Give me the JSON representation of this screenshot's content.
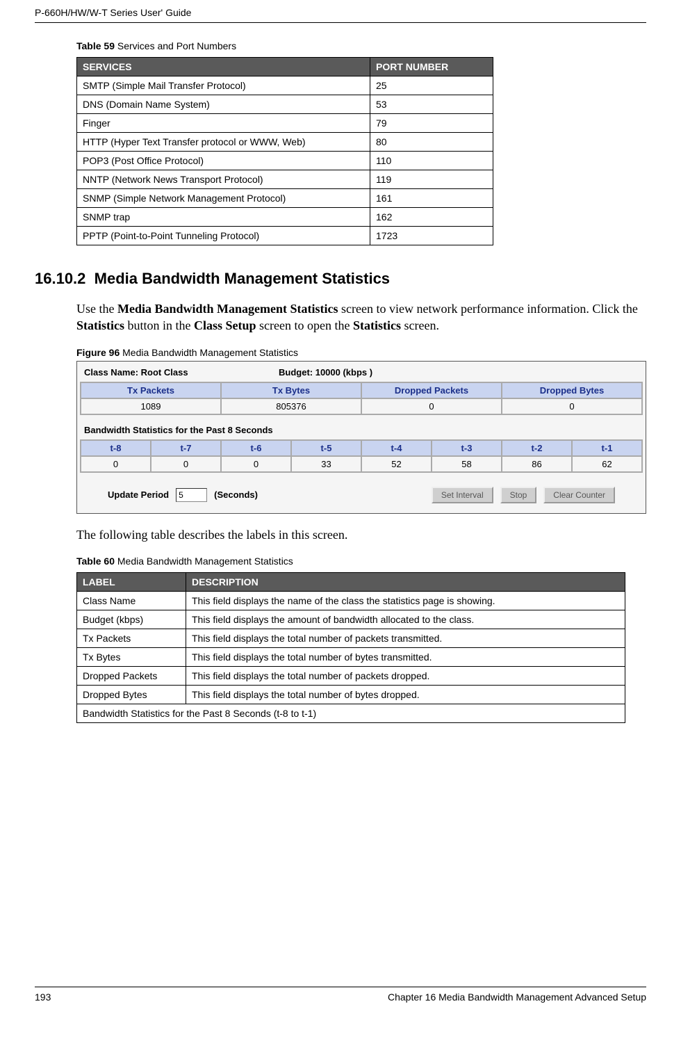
{
  "header": {
    "title": "P-660H/HW/W-T Series User' Guide"
  },
  "table59": {
    "caption_bold": "Table 59",
    "caption_rest": "   Services and Port Numbers",
    "headers": [
      "SERVICES",
      "PORT NUMBER"
    ],
    "rows": [
      [
        "SMTP (Simple Mail Transfer Protocol)",
        "25"
      ],
      [
        "DNS (Domain Name System)",
        "53"
      ],
      [
        "Finger",
        "79"
      ],
      [
        "HTTP (Hyper Text Transfer protocol or WWW, Web)",
        "80"
      ],
      [
        "POP3 (Post Office Protocol)",
        "110"
      ],
      [
        "NNTP (Network News Transport Protocol)",
        "119"
      ],
      [
        "SNMP (Simple Network Management Protocol)",
        "161"
      ],
      [
        "SNMP trap",
        "162"
      ],
      [
        "PPTP (Point-to-Point Tunneling Protocol)",
        "1723"
      ]
    ]
  },
  "section": {
    "number": "16.10.2",
    "title": "Media Bandwidth Management Statistics",
    "para_parts": {
      "t1": "Use the ",
      "b1": "Media Bandwidth Management Statistics",
      "t2": " screen to view network performance information. Click the ",
      "b2": "Statistics",
      "t3": " button in the ",
      "b3": "Class Setup",
      "t4": " screen to open the ",
      "b4": "Statistics",
      "t5": " screen."
    }
  },
  "figure96": {
    "caption_bold": "Figure 96",
    "caption_rest": "   Media Bandwidth Management Statistics",
    "class_name_label": "Class Name: Root Class",
    "budget_label": "Budget: 10000 (kbps )",
    "top_headers": [
      "Tx Packets",
      "Tx Bytes",
      "Dropped Packets",
      "Dropped Bytes"
    ],
    "top_values": [
      "1089",
      "805376",
      "0",
      "0"
    ],
    "sub_heading": "Bandwidth Statistics for the Past 8 Seconds",
    "sec_headers": [
      "t-8",
      "t-7",
      "t-6",
      "t-5",
      "t-4",
      "t-3",
      "t-2",
      "t-1"
    ],
    "sec_values": [
      "0",
      "0",
      "0",
      "33",
      "52",
      "58",
      "86",
      "62"
    ],
    "update_label": "Update Period",
    "update_value": "5",
    "seconds_label": "(Seconds)",
    "btn_set": "Set Interval",
    "btn_stop": "Stop",
    "btn_clear": "Clear Counter"
  },
  "after_figure": "The following table describes the labels in this screen.",
  "table60": {
    "caption_bold": "Table 60",
    "caption_rest": "   Media Bandwidth Management Statistics",
    "headers": [
      "LABEL",
      "DESCRIPTION"
    ],
    "rows": [
      [
        "Class Name",
        "This field displays the name of the class the statistics page is showing."
      ],
      [
        "Budget (kbps)",
        "This field displays the amount of bandwidth allocated to the class."
      ],
      [
        "Tx Packets",
        "This field displays the total number of packets transmitted."
      ],
      [
        "Tx Bytes",
        "This field displays the total number of bytes transmitted."
      ],
      [
        "Dropped Packets",
        "This field displays the total number of packets dropped."
      ],
      [
        "Dropped Bytes",
        "This field displays the total number of bytes dropped."
      ]
    ],
    "span_row": "Bandwidth Statistics for the Past 8 Seconds (t-8 to t-1)"
  },
  "footer": {
    "page": "193",
    "chapter": "Chapter 16 Media Bandwidth Management Advanced Setup"
  },
  "chart_data": {
    "type": "table",
    "tables": [
      {
        "title": "Services and Port Numbers",
        "columns": [
          "SERVICES",
          "PORT NUMBER"
        ],
        "rows": [
          [
            "SMTP (Simple Mail Transfer Protocol)",
            25
          ],
          [
            "DNS (Domain Name System)",
            53
          ],
          [
            "Finger",
            79
          ],
          [
            "HTTP (Hyper Text Transfer protocol or WWW, Web)",
            80
          ],
          [
            "POP3 (Post Office Protocol)",
            110
          ],
          [
            "NNTP (Network News Transport Protocol)",
            119
          ],
          [
            "SNMP (Simple Network Management Protocol)",
            161
          ],
          [
            "SNMP trap",
            162
          ],
          [
            "PPTP (Point-to-Point Tunneling Protocol)",
            1723
          ]
        ]
      },
      {
        "title": "Media Bandwidth Management Statistics (summary)",
        "columns": [
          "Tx Packets",
          "Tx Bytes",
          "Dropped Packets",
          "Dropped Bytes"
        ],
        "rows": [
          [
            1089,
            805376,
            0,
            0
          ]
        ]
      },
      {
        "title": "Bandwidth Statistics for the Past 8 Seconds",
        "columns": [
          "t-8",
          "t-7",
          "t-6",
          "t-5",
          "t-4",
          "t-3",
          "t-2",
          "t-1"
        ],
        "rows": [
          [
            0,
            0,
            0,
            33,
            52,
            58,
            86,
            62
          ]
        ]
      }
    ]
  }
}
